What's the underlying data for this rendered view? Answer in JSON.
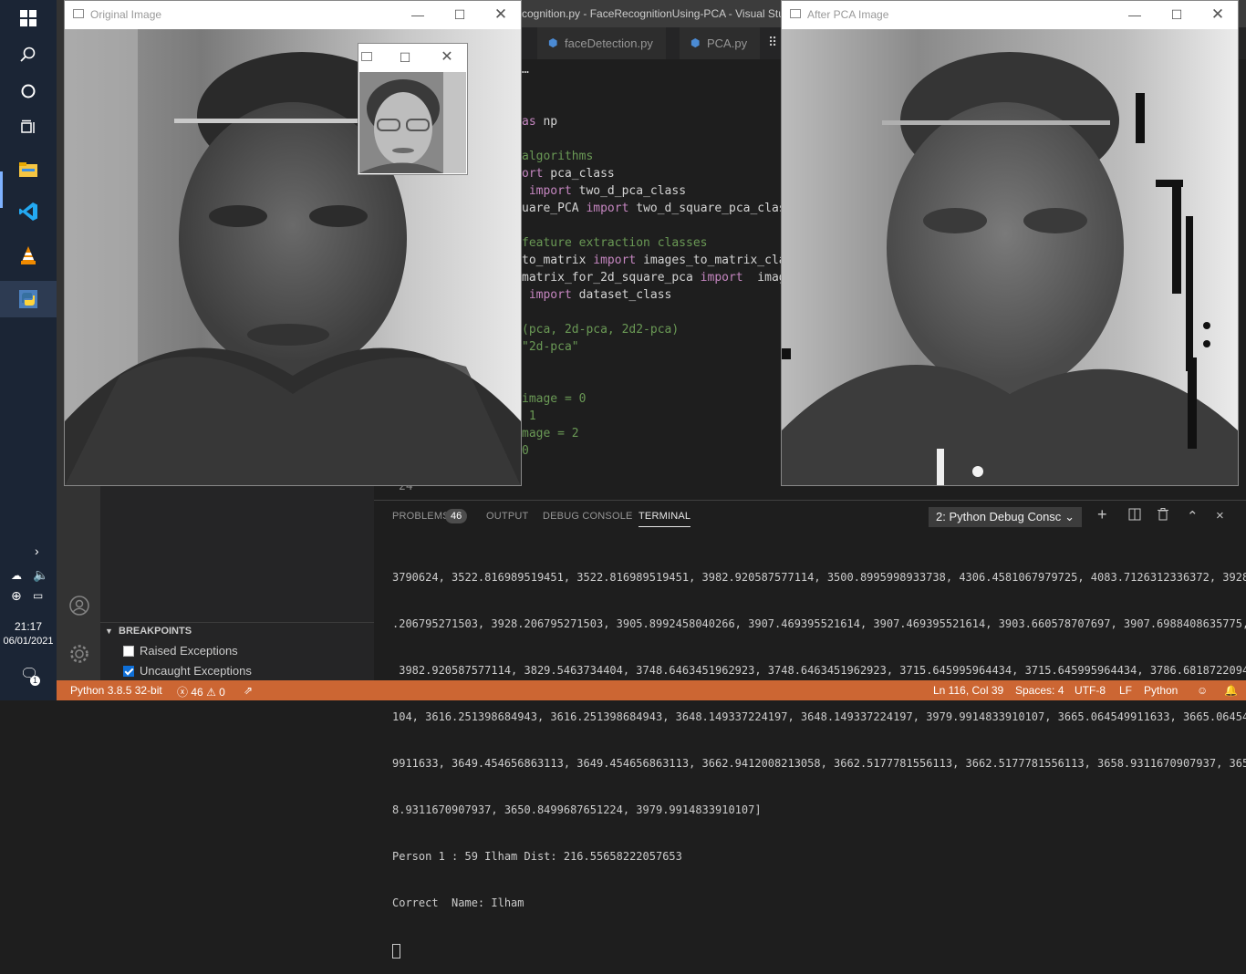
{
  "taskbar": {
    "clock_time": "21:17",
    "clock_date": "06/01/2021",
    "notifications_count": "1",
    "icons": [
      "windows-start-icon",
      "search-icon",
      "cortana-icon",
      "task-view-icon",
      "file-explorer-icon",
      "vscode-icon",
      "vlc-icon",
      "python-icon"
    ]
  },
  "vscode": {
    "window_title": "cognition.py - FaceRecognitionUsing-PCA - Visual Studio Code",
    "tabs": [
      {
        "label": "faceDetection.py"
      },
      {
        "label": "PCA.py"
      }
    ],
    "breadcrumb_ellipsis": "…",
    "code": [
      {
        "a": "as",
        "b": " np"
      },
      {
        "a": "algorithms"
      },
      {
        "a": "ort",
        "b": " pca_class"
      },
      {
        "a": " import",
        "b": " two_d_pca_class"
      },
      {
        "a": "uare_PCA",
        "b": " import",
        "c": " two_d_square_pca_class"
      },
      {
        "a": "feature extraction classes"
      },
      {
        "a": "to_matrix",
        "b": " import",
        "c": " images_to_matrix_cla"
      },
      {
        "a": "matrix_for_2d_square_pca",
        "b": " import",
        "c": "  imag"
      },
      {
        "a": " import",
        "b": " dataset_class"
      },
      {
        "a": "(pca, 2d-pca, 2d2-pca)"
      },
      {
        "a": "\"2d-pca\""
      },
      {
        "a": "image = 0"
      },
      {
        "a": " 1"
      },
      {
        "a": "mage = 2"
      },
      {
        "a": "0"
      }
    ],
    "line_number_24": "24"
  },
  "panel": {
    "tabs": {
      "problems": "PROBLEMS",
      "problems_count": "46",
      "output": "OUTPUT",
      "debug_console": "DEBUG CONSOLE",
      "terminal": "TERMINAL"
    },
    "terminal_select": "2: Python Debug Consc",
    "terminal_lines": [
      "3790624, 3522.816989519451, 3522.816989519451, 3982.920587577114, 3500.8995998933738, 4306.4581067979725, 4083.7126312336372, 3928",
      ".206795271503, 3928.206795271503, 3905.8992458040266, 3907.469395521614, 3907.469395521614, 3903.660578707697, 3907.6988408635775,",
      " 3982.920587577114, 3829.5463734404, 3748.6463451962923, 3748.6463451962923, 3715.645995964434, 3715.645995964434, 3786.6818722094",
      "104, 3616.251398684943, 3616.251398684943, 3648.149337224197, 3648.149337224197, 3979.9914833910107, 3665.064549911633, 3665.06454",
      "9911633, 3649.454656863113, 3649.454656863113, 3662.9412008213058, 3662.5177781556113, 3662.5177781556113, 3658.9311670907937, 365",
      "8.9311670907937, 3650.8499687651224, 3979.9914833910107]",
      "Person 1 : 59 Ilham Dist: 216.55658222057653",
      "Correct  Name: Ilham"
    ]
  },
  "breakpoints": {
    "header": "BREAKPOINTS",
    "raised_exceptions": "Raised Exceptions",
    "uncaught_exceptions": "Uncaught Exceptions",
    "raised_checked": false,
    "uncaught_checked": true
  },
  "statusbar": {
    "interpreter": "Python 3.8.5 32-bit",
    "errors": "46",
    "warnings": "0",
    "position": "Ln 116, Col 39",
    "spaces": "Spaces: 4",
    "encoding": "UTF-8",
    "eol": "LF",
    "language": "Python",
    "color": "#cc6633"
  },
  "windows": {
    "original_title": "Original Image",
    "after_pca_title": "After PCA Image"
  }
}
